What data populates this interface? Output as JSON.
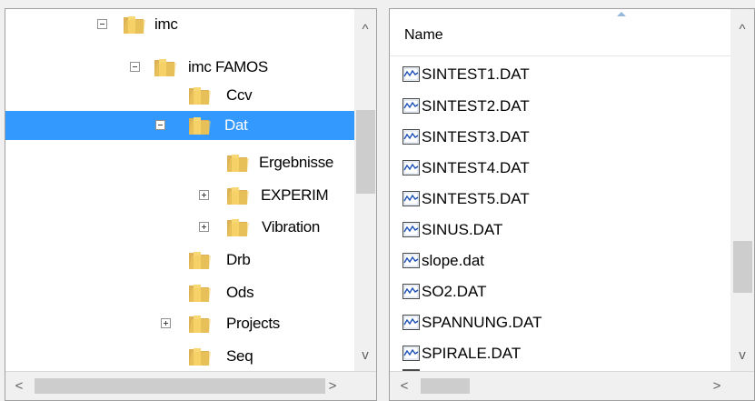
{
  "tree": {
    "items": [
      {
        "label": "imc",
        "expander": "minus"
      },
      {
        "label": "imc FAMOS",
        "expander": "minus"
      },
      {
        "label": "Ccv",
        "expander": ""
      },
      {
        "label": "Dat",
        "expander": "minus",
        "selected": true
      },
      {
        "label": "Ergebnisse",
        "expander": ""
      },
      {
        "label": "EXPERIM",
        "expander": "plus"
      },
      {
        "label": "Vibration",
        "expander": "plus"
      },
      {
        "label": "Drb",
        "expander": ""
      },
      {
        "label": "Ods",
        "expander": ""
      },
      {
        "label": "Projects",
        "expander": "plus"
      },
      {
        "label": "Seq",
        "expander": ""
      }
    ],
    "scroll_up_glyph": "^",
    "scroll_down_glyph": "v",
    "scroll_left_glyph": "<",
    "scroll_right_glyph": ">"
  },
  "list": {
    "column_header": "Name",
    "files": [
      "SINTEST1.DAT",
      "SINTEST2.DAT",
      "SINTEST3.DAT",
      "SINTEST4.DAT",
      "SINTEST5.DAT",
      "SINUS.DAT",
      "slope.dat",
      "SO2.DAT",
      "SPANNUNG.DAT",
      "SPIRALE.DAT"
    ],
    "scroll_up_glyph": "^",
    "scroll_down_glyph": "v",
    "scroll_left_glyph": "<",
    "scroll_right_glyph": ">"
  },
  "colors": {
    "selection": "#3399ff",
    "folder_light": "#f8d775",
    "folder_dark": "#dcb255",
    "waveform": "#1a4fb8"
  },
  "icons": {
    "folder": "folder-icon",
    "file": "waveform-file-icon",
    "sort": "sort-ascending-icon"
  }
}
